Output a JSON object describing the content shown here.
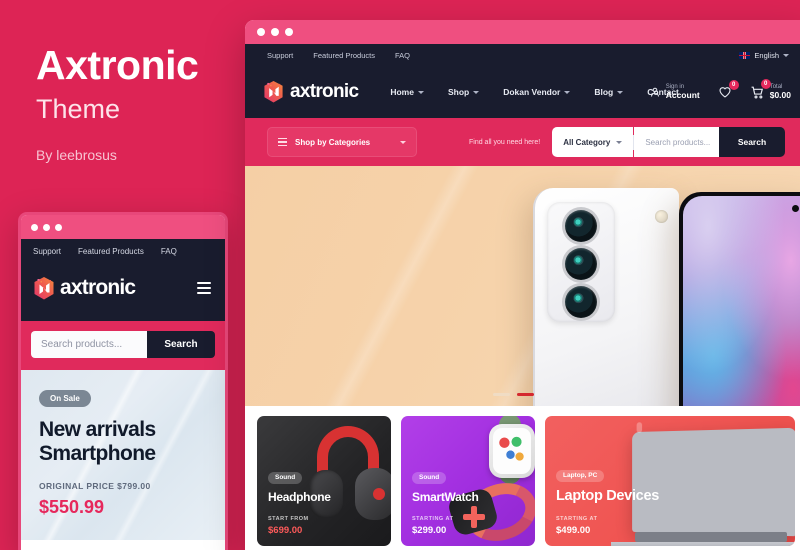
{
  "promo": {
    "title": "Axtronic",
    "subtitle": "Theme",
    "author": "By leebrosus"
  },
  "colors": {
    "background": "#dd2455",
    "titlebar": "#ef4f80",
    "navy": "#191c2e",
    "accent_pink": "#e02a5c",
    "price_red": "#e6285c"
  },
  "mobile": {
    "titlebar_dots": 3,
    "topbar_links": [
      "Support",
      "Featured Products",
      "FAQ"
    ],
    "logo_text": "axtronic",
    "menu_icon": "hamburger-icon",
    "search": {
      "placeholder": "Search products...",
      "button_label": "Search"
    },
    "hero": {
      "badge": "On Sale",
      "title_line1": "New arrivals",
      "title_line2": "Smartphone",
      "original_price_label": "ORIGINAL PRICE $799.00",
      "price": "$550.99"
    }
  },
  "browser": {
    "titlebar_dots": 3,
    "topbar": {
      "links": [
        "Support",
        "Featured Products",
        "FAQ"
      ],
      "language": {
        "flag": "uk-flag-icon",
        "label": "English",
        "chevron": "chevron-down-icon"
      }
    },
    "nav": {
      "logo_text": "axtronic",
      "logo_mark": "hexagon-cube-logo-icon",
      "menu": [
        {
          "label": "Home",
          "has_dropdown": true
        },
        {
          "label": "Shop",
          "has_dropdown": true
        },
        {
          "label": "Dokan Vendor",
          "has_dropdown": true
        },
        {
          "label": "Blog",
          "has_dropdown": true
        },
        {
          "label": "Contact",
          "has_dropdown": false
        }
      ],
      "account": {
        "icon": "user-icon",
        "small": "Sign in",
        "big": "Account"
      },
      "wishlist": {
        "icon": "heart-icon",
        "count": "0"
      },
      "cart": {
        "icon": "shopping-cart-icon",
        "count": "0",
        "small": "Total",
        "big": "$0.00"
      }
    },
    "searchbar": {
      "categories_icon": "hamburger-icon",
      "categories_label": "Shop by Categories",
      "categories_chevron": "chevron-down-icon",
      "find_text": "Find all you need here!",
      "all_category_label": "All Category",
      "all_category_chevron": "chevron-down-icon",
      "products_placeholder": "Search products...",
      "search_button": "Search"
    },
    "hero": {
      "image": "white-smartphone-triple-camera",
      "slider_dots": 2,
      "active_dot_index": 1
    },
    "cards": [
      {
        "tag": "Sound",
        "title": "Headphone",
        "from_label": "START FROM",
        "price": "$699.00",
        "art": "red-black-headphones"
      },
      {
        "tag": "Sound",
        "title": "SmartWatch",
        "from_label": "STARTING AT",
        "price": "$299.00",
        "art": "smartwatch-pair"
      },
      {
        "tag": "Laptop, PC",
        "title": "Laptop Devices",
        "from_label": "STARTING AT",
        "price": "$499.00",
        "art": "macbook-laptop"
      }
    ]
  }
}
